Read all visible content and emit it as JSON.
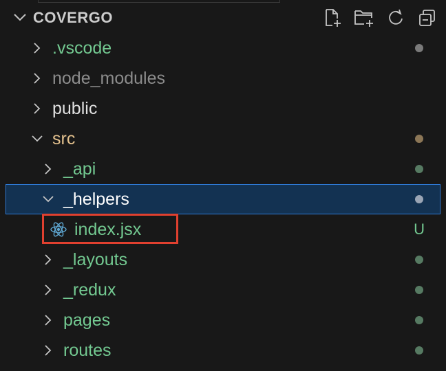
{
  "explorer": {
    "folder_title": "COVERGO",
    "actions": [
      {
        "name": "new-file-icon"
      },
      {
        "name": "new-folder-icon"
      },
      {
        "name": "refresh-icon"
      },
      {
        "name": "collapse-all-icon"
      }
    ]
  },
  "tree": [
    {
      "label": ".vscode",
      "kind": "folder",
      "expanded": false,
      "depth": 0,
      "color": "#73c991",
      "status": "dot",
      "status_color": "#7a7a7a"
    },
    {
      "label": "node_modules",
      "kind": "folder",
      "expanded": false,
      "depth": 0,
      "color": "#8c8c8c",
      "status": "",
      "status_color": ""
    },
    {
      "label": "public",
      "kind": "folder",
      "expanded": false,
      "depth": 0,
      "color": "#e0e0e0",
      "status": "",
      "status_color": ""
    },
    {
      "label": "src",
      "kind": "folder",
      "expanded": true,
      "depth": 0,
      "color": "#e2c08d",
      "status": "dot",
      "status_color": "#8b7656"
    },
    {
      "label": "_api",
      "kind": "folder",
      "expanded": false,
      "depth": 1,
      "color": "#73c991",
      "status": "dot",
      "status_color": "#567a62"
    },
    {
      "label": "_helpers",
      "kind": "folder",
      "expanded": true,
      "depth": 1,
      "color": "#ffffff",
      "status": "dot",
      "status_color": "#9aa5b5",
      "selected": true
    },
    {
      "label": "index.jsx",
      "kind": "file",
      "depth": 2,
      "color": "#73c991",
      "status": "U",
      "status_color": "#73c991"
    },
    {
      "label": "_layouts",
      "kind": "folder",
      "expanded": false,
      "depth": 1,
      "color": "#73c991",
      "status": "dot",
      "status_color": "#567a62"
    },
    {
      "label": "_redux",
      "kind": "folder",
      "expanded": false,
      "depth": 1,
      "color": "#73c991",
      "status": "dot",
      "status_color": "#567a62"
    },
    {
      "label": "pages",
      "kind": "folder",
      "expanded": false,
      "depth": 1,
      "color": "#73c991",
      "status": "dot",
      "status_color": "#567a62"
    },
    {
      "label": "routes",
      "kind": "folder",
      "expanded": false,
      "depth": 1,
      "color": "#73c991",
      "status": "dot",
      "status_color": "#567a62"
    }
  ],
  "colors": {
    "background": "#181818",
    "selection_bg": "#133252",
    "selection_border": "#2f7bd8",
    "highlight_box": "#e0402f",
    "react_icon": "#5fa8d3"
  }
}
